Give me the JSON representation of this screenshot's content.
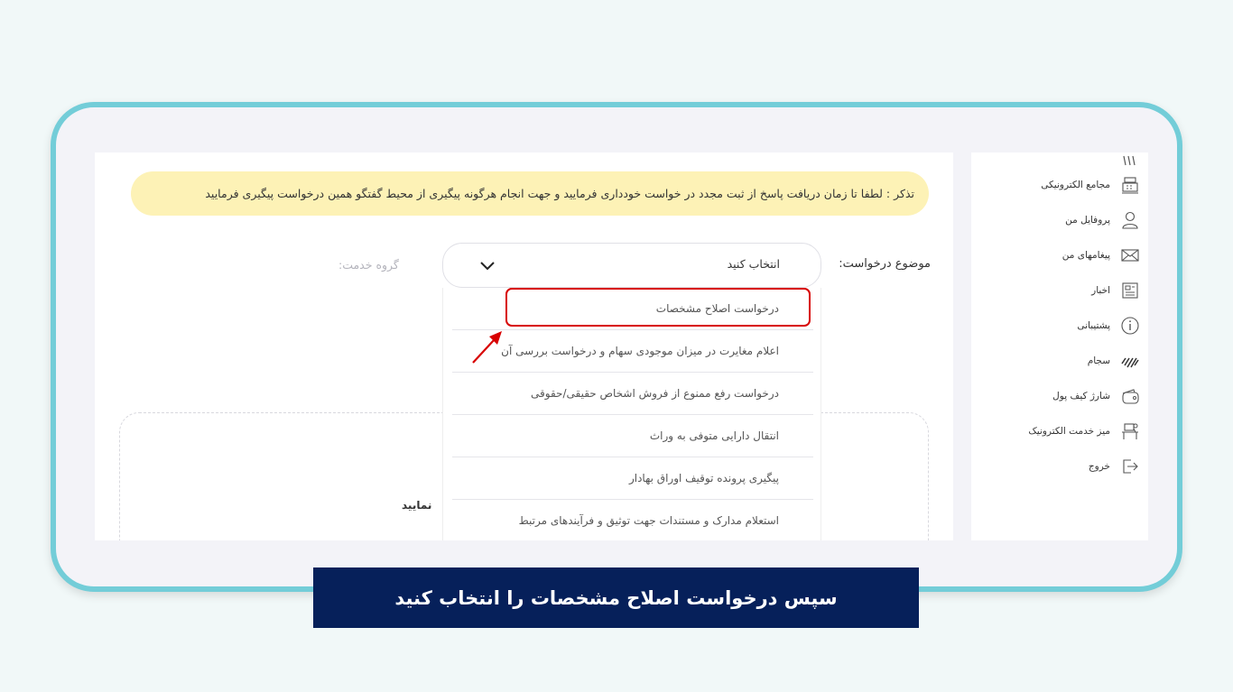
{
  "sidebar": {
    "items": [
      {
        "label": "مجامع الکترونیکی",
        "icon": "building-icon"
      },
      {
        "label": "پروفایل من",
        "icon": "user-icon"
      },
      {
        "label": "پیغامهای من",
        "icon": "envelope-icon"
      },
      {
        "label": "اخبار",
        "icon": "newspaper-icon"
      },
      {
        "label": "پشتیبانی",
        "icon": "info-icon"
      },
      {
        "label": "سجام",
        "icon": "sejam-logo-icon"
      },
      {
        "label": "شارژ کیف پول",
        "icon": "wallet-icon"
      },
      {
        "label": "میز خدمت الکترونیک",
        "icon": "service-desk-icon"
      },
      {
        "label": "خروج",
        "icon": "logout-icon"
      }
    ]
  },
  "notice": {
    "text": "تذکر : لطفا تا زمان دریافت پاسخ از ثبت مجدد در خواست خودداری فرمایید و جهت انجام هرگونه پیگیری از محیط گفتگو همین درخواست پیگیری فرمایید"
  },
  "form": {
    "subject_label": "موضوع درخواست:",
    "group_label": "گروه خدمت:",
    "select_value": "انتخاب کنید",
    "upload_hint": "نمایید"
  },
  "dropdown": {
    "options": [
      "درخواست اصلاح مشخصات",
      "اعلام مغایرت در میزان موجودی سهام و درخواست بررسی آن",
      "درخواست رفع ممنوع از فروش اشخاص حقیقی/حقوقی",
      "انتقال دارایی متوفی به وراث",
      "پیگیری پرونده توقیف اوراق بهادار",
      "استعلام مدارک و مستندات جهت توثیق و فرآیندهای مرتبط"
    ]
  },
  "caption": {
    "text": "سپس درخواست اصلاح مشخصات را انتخاب کنید"
  },
  "colors": {
    "frame_border": "#73cdd8",
    "notice_bg": "#fdf2b6",
    "highlight": "#d80000",
    "caption_bg": "#06205a"
  }
}
